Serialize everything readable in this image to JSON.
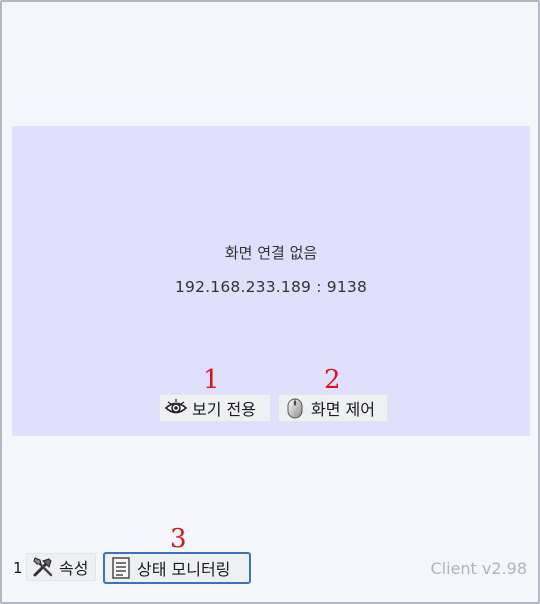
{
  "screen": {
    "status_title": "화면 연결 없음",
    "address": "192.168.233.189 : 9138",
    "view_only_label": "보기 전용",
    "screen_control_label": "화면 제어"
  },
  "markers": {
    "m1": "1",
    "m2": "2",
    "m3": "3"
  },
  "bottom_bar": {
    "index": "1",
    "properties_label": "속성",
    "monitoring_label": "상태 모니터링",
    "version": "Client v2.98"
  },
  "icons": {
    "view_only": "eye-icon",
    "screen_control": "mouse-icon",
    "properties": "tools-icon",
    "monitoring": "document-list-icon"
  }
}
